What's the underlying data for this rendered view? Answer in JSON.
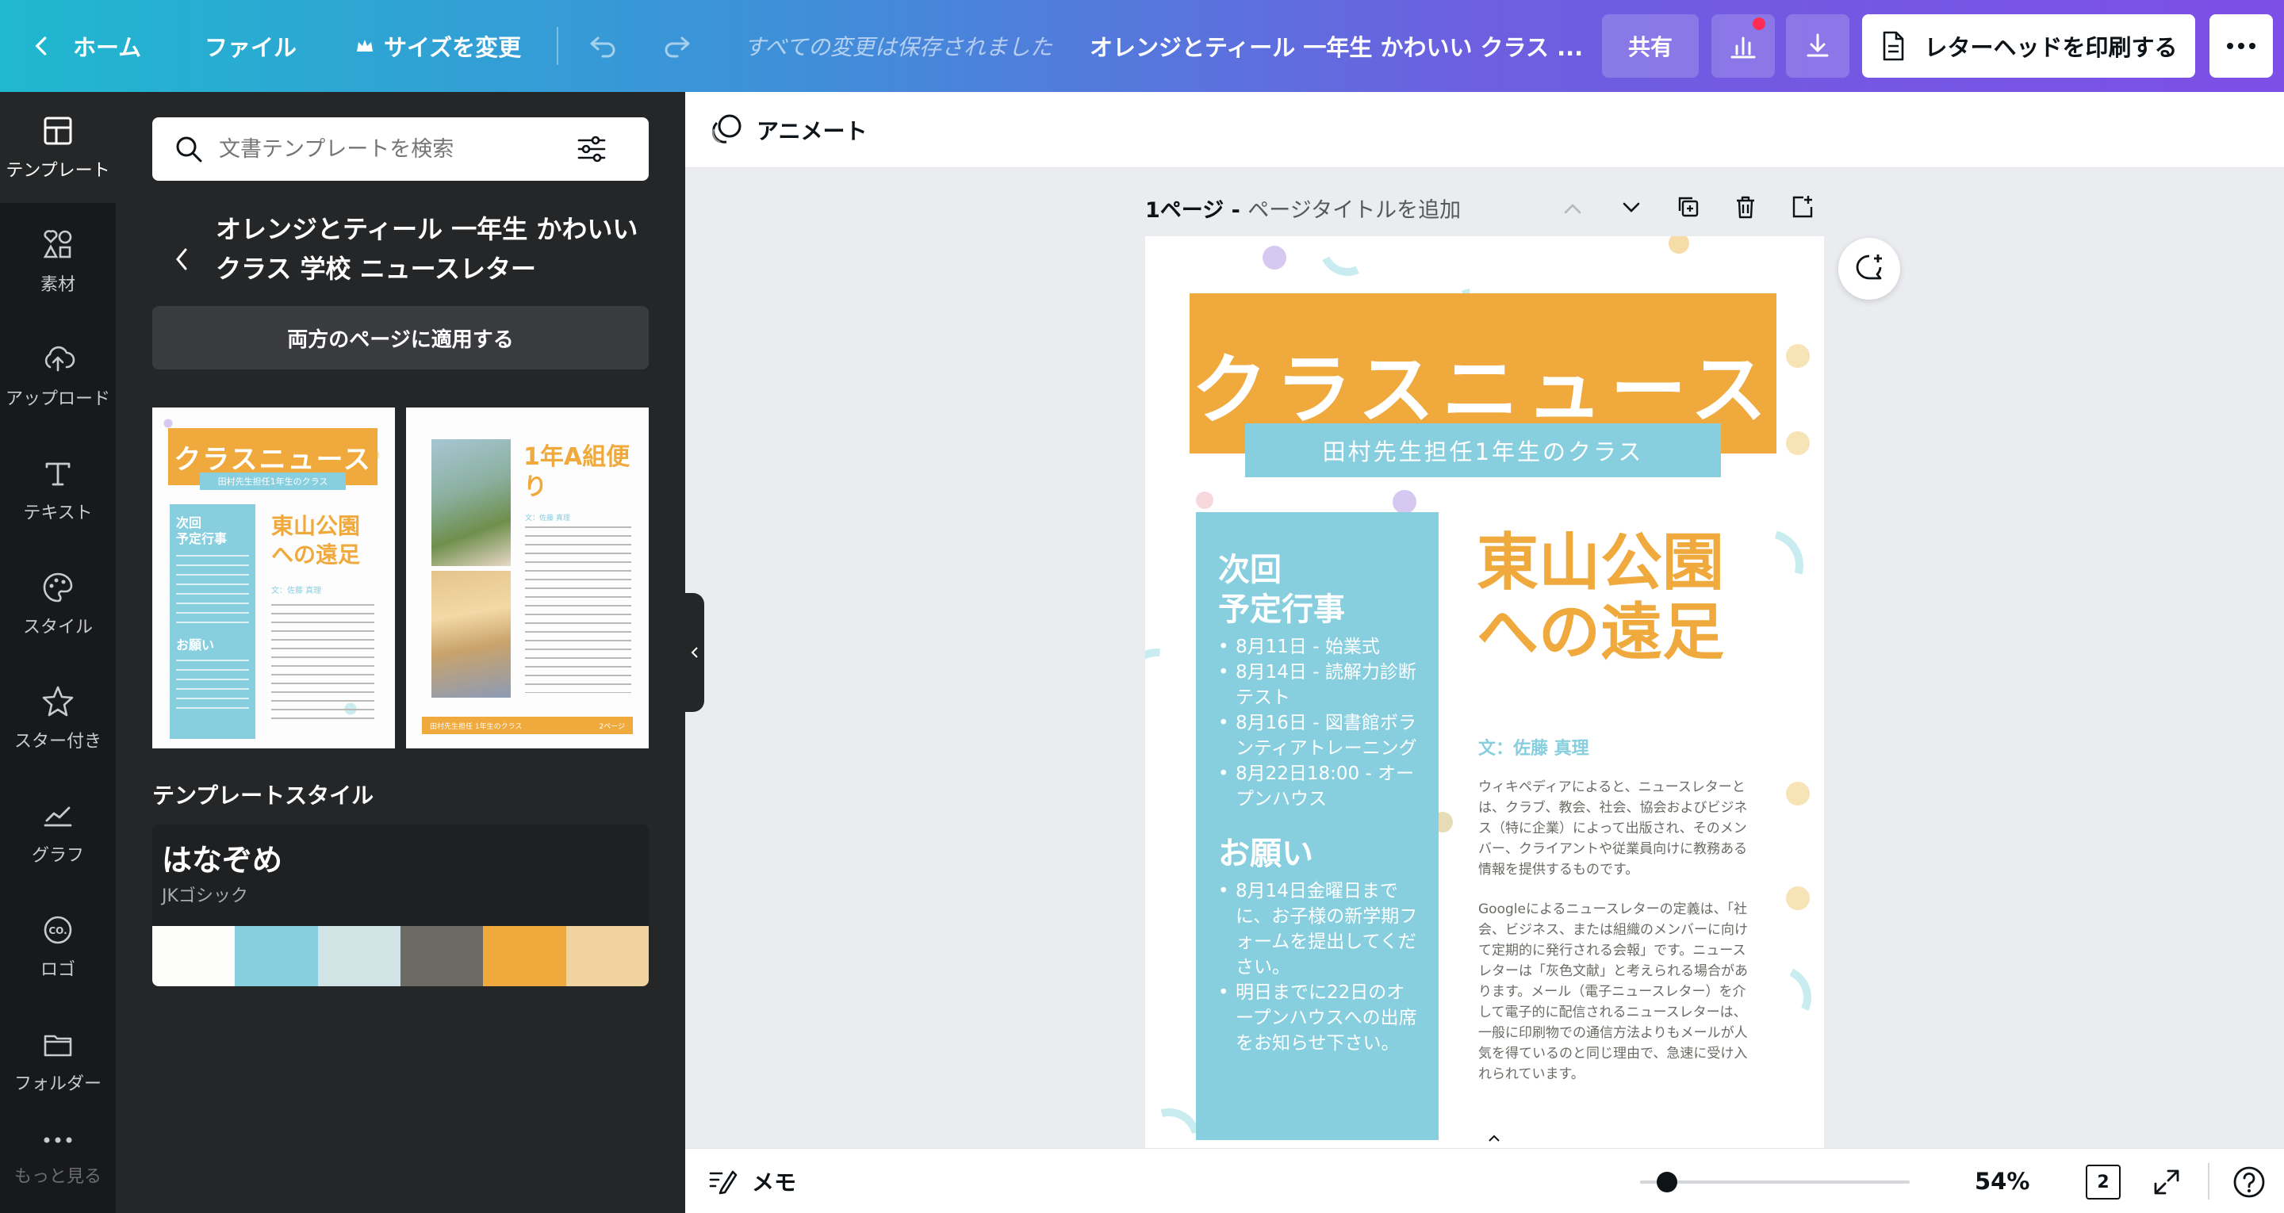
{
  "topbar": {
    "home": "ホーム",
    "file": "ファイル",
    "resize": "サイズを変更",
    "saved_status": "すべての変更は保存されました",
    "doc_title": "オレンジとティール 一年生 かわいい クラス ...",
    "share": "共有",
    "print": "レターヘッドを印刷する",
    "colors": {
      "gradient_start": "#1fb8cf",
      "gradient_end": "#7d4fe6",
      "print_btn_bg": "#ffffff"
    }
  },
  "rail": {
    "items": [
      {
        "label": "テンプレート",
        "icon": "template-icon"
      },
      {
        "label": "素材",
        "icon": "elements-icon"
      },
      {
        "label": "アップロード",
        "icon": "upload-icon"
      },
      {
        "label": "テキスト",
        "icon": "text-icon"
      },
      {
        "label": "スタイル",
        "icon": "palette-icon"
      },
      {
        "label": "スター付き",
        "icon": "star-icon"
      },
      {
        "label": "グラフ",
        "icon": "chart-icon"
      },
      {
        "label": "ロゴ",
        "icon": "logo-icon"
      },
      {
        "label": "フォルダー",
        "icon": "folder-icon"
      },
      {
        "label": "もっと見る",
        "icon": "more-icon"
      }
    ]
  },
  "panel": {
    "search_placeholder": "文書テンプレートを検索",
    "template_title": "オレンジとティール 一年生 かわいい クラス 学校 ニュースレター",
    "apply_both": "両方のページに適用する",
    "thumb1": {
      "title": "クラスニュース",
      "subtitle": "田村先生担任1年生のクラス",
      "side_head": "次回\n予定行事",
      "side_head2": "お願い",
      "main_head": "東山公園への遠足",
      "byline": "文：佐藤 真理"
    },
    "thumb2": {
      "title": "1年A組便り",
      "byline": "文：佐藤 真理",
      "footer_left": "田村先生担任 1年生のクラス",
      "footer_right": "2ページ"
    },
    "style_section_title": "テンプレートスタイル",
    "style": {
      "font_name": "はなぞめ",
      "font_sub": "JKゴシック",
      "palette": [
        "#fdfdfc",
        "#87cfdf",
        "#d1e3e4",
        "#6b6a65",
        "#efa93d",
        "#f0d39f"
      ]
    }
  },
  "canvas_toolbar": {
    "animate": "アニメート"
  },
  "page_header": {
    "label": "1ページ - ",
    "placeholder": "ページタイトルを追加"
  },
  "newsletter": {
    "title": "クラスニュース",
    "subtitle": "田村先生担任1年生のクラス",
    "side_heading": "次回\n予定行事",
    "events": [
      "8月11日 - 始業式",
      "8月14日 - 読解力診断テスト",
      "8月16日 - 図書館ボランティアトレーニング",
      "8月22日18:00 - オープンハウス"
    ],
    "requests_heading": "お願い",
    "requests": [
      "8月14日金曜日までに、お子様の新学期フォームを提出してください。",
      "明日までに22日のオープンハウスへの出席をお知らせ下さい。"
    ],
    "main_heading": "東山公園への遠足",
    "byline": "文：佐藤 真理",
    "para1": "ウィキペディアによると、ニュースレターとは、クラブ、教会、社会、協会およびビジネス（特に企業）によって出版され、そのメンバー、クライアントや従業員向けに教務ある情報を提供するものです。",
    "para2": "Googleによるニュースレターの定義は、「社会、ビジネス、または組織のメンバーに向けて定期的に発行される会報」です。ニュースレターは「灰色文献」と考えられる場合があります。メール（電子ニュースレター）を介して電子的に配信されるニュースレターは、一般に印刷物での通信方法よりもメールが人気を得ているのと同じ理由で、急速に受け入れられています。",
    "colors": {
      "orange": "#efa93d",
      "teal": "#87cfdf",
      "text": "#6b6a65"
    }
  },
  "bottombar": {
    "notes": "メモ",
    "zoom": "54%",
    "page_count": "2",
    "zoom_level": 0.1
  }
}
